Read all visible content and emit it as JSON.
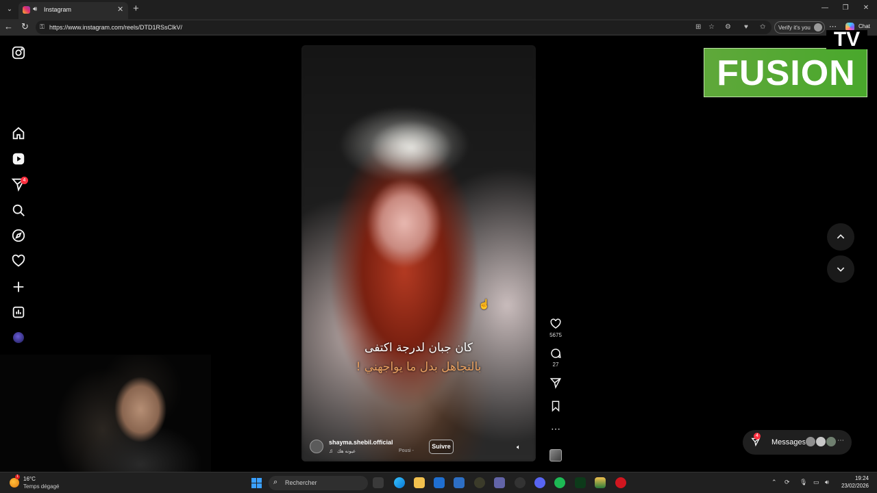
{
  "browser": {
    "tab_title": "Instagram",
    "url": "https://www.instagram.com/reels/DTD1RSsClkV/",
    "verify_label": "Verify it's you",
    "chat_label": "Chat",
    "new_tab": "+",
    "close_tab": "✕"
  },
  "sidebar": {
    "items": [
      {
        "name": "instagram-logo-icon"
      },
      {
        "name": "home-icon"
      },
      {
        "name": "reels-icon"
      },
      {
        "name": "messages-icon",
        "badge": "4"
      },
      {
        "name": "search-icon"
      },
      {
        "name": "explore-icon"
      },
      {
        "name": "notifications-icon"
      },
      {
        "name": "create-icon"
      },
      {
        "name": "dashboard-icon"
      },
      {
        "name": "profile-avatar"
      },
      {
        "name": "more-menu-icon"
      },
      {
        "name": "also-from-meta-icon"
      }
    ]
  },
  "reel": {
    "subtitle_line1": "كان جبان لدرجة اكتفى",
    "subtitle_line2": "بالتجاهل بدل ما يواجهني !",
    "author": "shayma.shebil.official",
    "audio": "عيونه هك",
    "audio_2": "Pousi -",
    "follow_label": "Suivre"
  },
  "actions": {
    "likes": "5675",
    "comments": "27"
  },
  "overlay": {
    "logo_main": "FUSION",
    "logo_tv": "TV"
  },
  "messages": {
    "label": "Messages",
    "badge": "4"
  },
  "taskbar": {
    "weather_temp": "16°C",
    "weather_desc": "Temps dégagé",
    "weather_badge": "1",
    "search_placeholder": "Rechercher",
    "time": "19:24",
    "date": "23/02/2026"
  },
  "colors": {
    "notification_red": "#ff3040",
    "fusion_green": "#5fa83a",
    "subtitle_orange": "#e8a060"
  }
}
